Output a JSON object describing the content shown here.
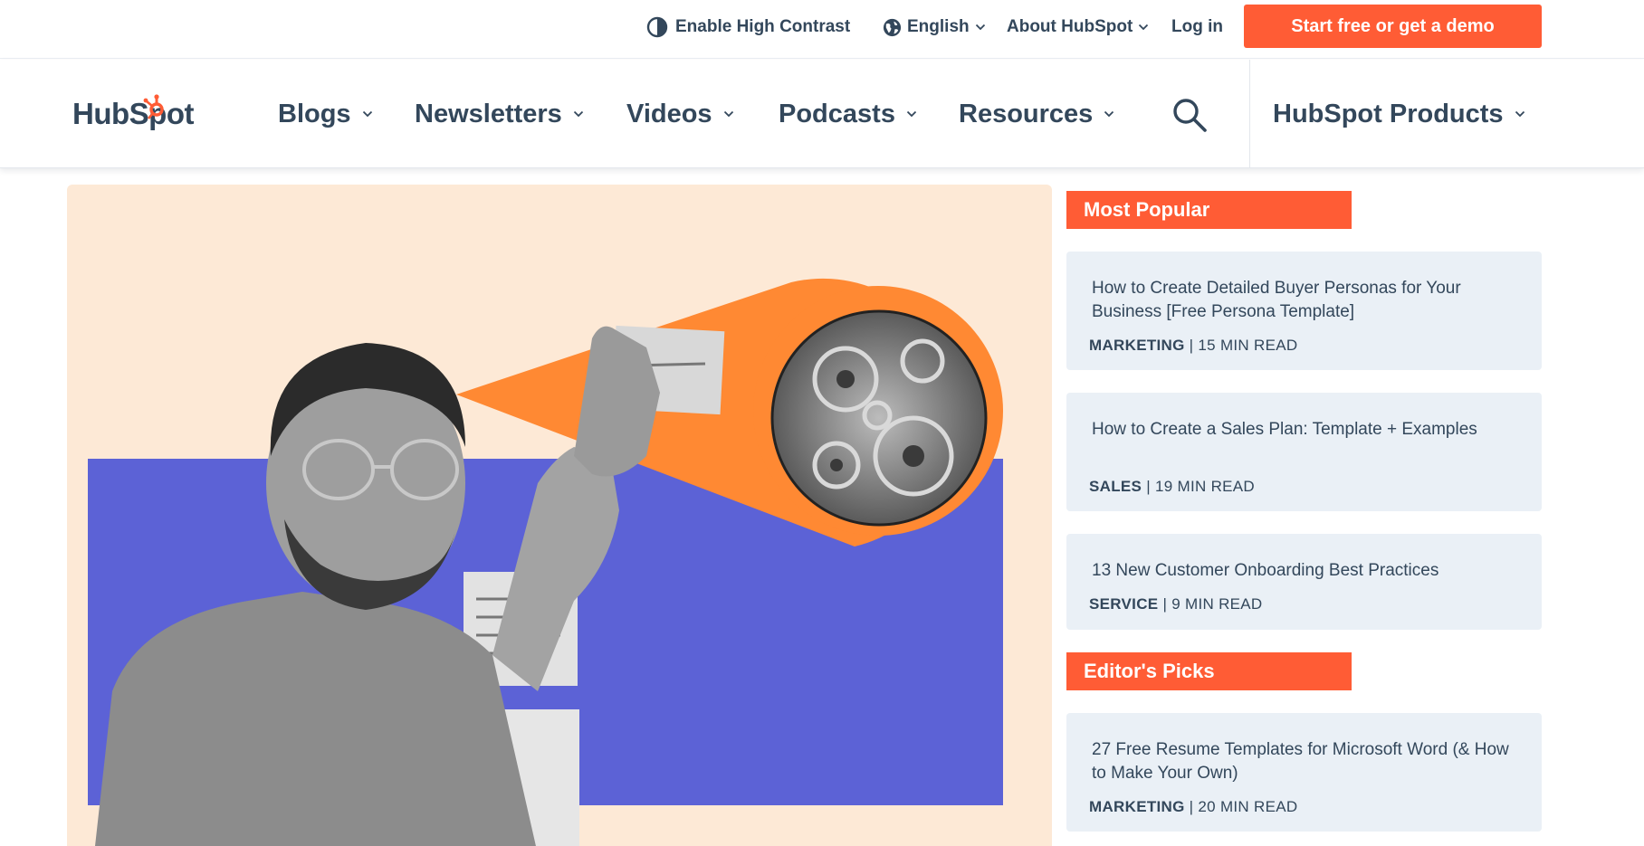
{
  "utility": {
    "contrast_label": "Enable High Contrast",
    "language_label": "English",
    "about_label": "About HubSpot",
    "login_label": "Log in",
    "cta_label": "Start free or get a demo"
  },
  "nav": {
    "logo_text": "HubSpot",
    "items": [
      {
        "label": "Blogs"
      },
      {
        "label": "Newsletters"
      },
      {
        "label": "Videos"
      },
      {
        "label": "Podcasts"
      },
      {
        "label": "Resources"
      }
    ],
    "search_icon": "search-icon",
    "products_label": "HubSpot Products"
  },
  "colors": {
    "accent": "#ff5c35",
    "text": "#33475b",
    "card_bg": "#eaf0f6",
    "hero_bg": "#fde9d6",
    "hero_purple": "#5c62d6",
    "hero_orange": "#ff8933"
  },
  "sidebar": {
    "most_popular": {
      "heading": "Most Popular",
      "cards": [
        {
          "title": "How to Create Detailed Buyer Personas for Your Business [Free Persona Template]",
          "category": "MARKETING",
          "read_time": "15 MIN READ"
        },
        {
          "title": "How to Create a Sales Plan: Template + Examples",
          "category": "SALES",
          "read_time": "19 MIN READ"
        },
        {
          "title": "13 New Customer Onboarding Best Practices",
          "category": "SERVICE",
          "read_time": "9 MIN READ"
        }
      ]
    },
    "editors_picks": {
      "heading": "Editor's Picks",
      "cards": [
        {
          "title": "27 Free Resume Templates for Microsoft Word (& How to Make Your Own)",
          "category": "MARKETING",
          "read_time": "20 MIN READ"
        }
      ]
    },
    "separator": " | "
  }
}
